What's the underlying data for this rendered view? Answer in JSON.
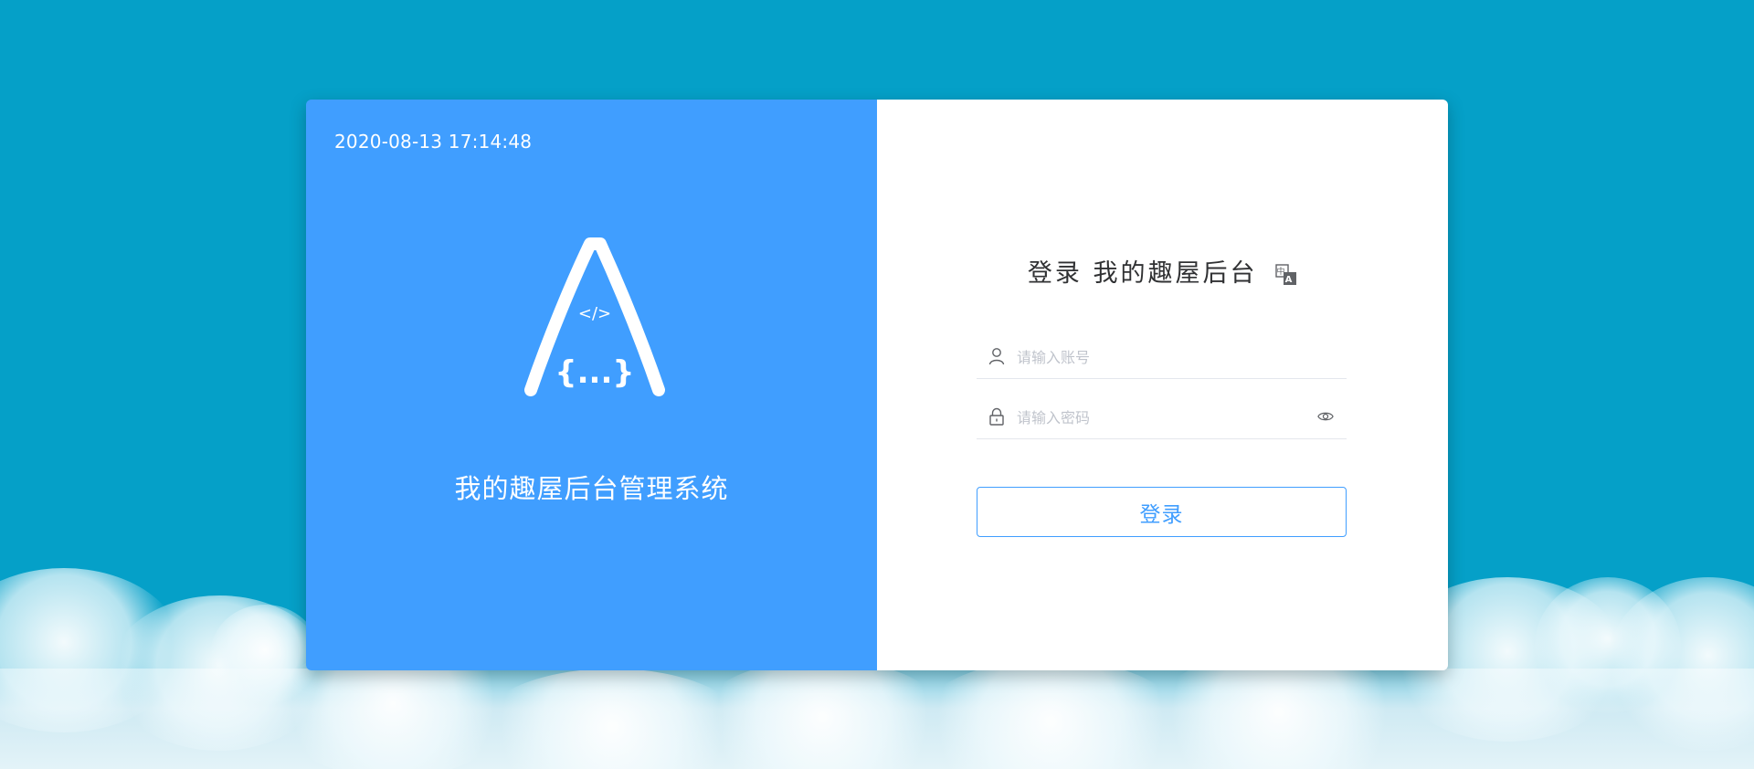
{
  "left_panel": {
    "datetime": "2020-08-13 17:14:48",
    "logo_letter": "A",
    "logo_code_top": "</>",
    "logo_code_bottom": "{...}",
    "system_name": "我的趣屋后台管理系统"
  },
  "login": {
    "title": "登录 我的趣屋后台",
    "username_placeholder": "请输入账号",
    "password_placeholder": "请输入密码",
    "submit_label": "登录"
  },
  "icons": {
    "language": "language-switch-icon",
    "user": "user-icon",
    "lock": "lock-icon",
    "eye": "eye-icon"
  },
  "colors": {
    "page_background": "#05a0c8",
    "left_panel": "#409eff",
    "accent": "#409eff"
  }
}
